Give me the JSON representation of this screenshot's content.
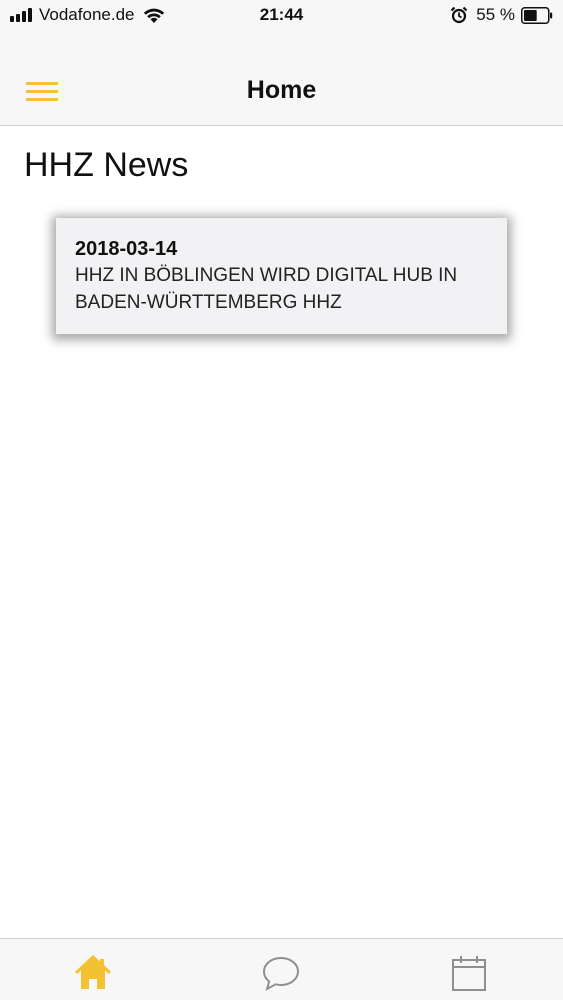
{
  "status_bar": {
    "carrier": "Vodafone.de",
    "time": "21:44",
    "battery_percent": "55 %",
    "signal_bars": 4,
    "battery_level": 0.55
  },
  "nav": {
    "title": "Home",
    "menu_icon": "hamburger-menu-icon",
    "accent_color": "#f2c230"
  },
  "main": {
    "heading": "HHZ News",
    "news": [
      {
        "date": "2018-03-14",
        "title": "HHZ IN BÖBLINGEN WIRD DIGITAL HUB IN BADEN-WÜRTTEMBERG HHZ"
      }
    ]
  },
  "tabs": [
    {
      "icon": "home-icon",
      "active": true
    },
    {
      "icon": "chat-icon",
      "active": false
    },
    {
      "icon": "calendar-icon",
      "active": false
    }
  ],
  "colors": {
    "accent": "#f2c230",
    "inactive_icon": "#8e8e93",
    "bar_background": "#f7f7f7",
    "card_background": "#f2f1f4"
  }
}
